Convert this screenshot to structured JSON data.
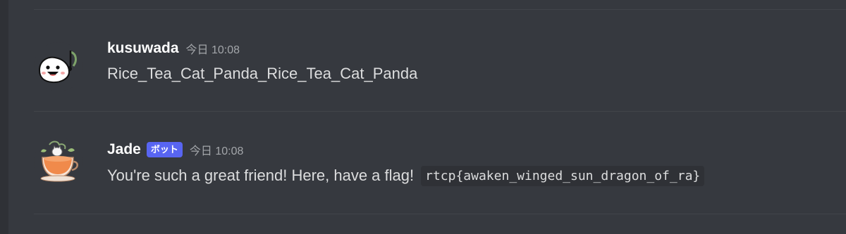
{
  "messages": [
    {
      "username": "kusuwada",
      "timestamp": "今日 10:08",
      "content": "Rice_Tea_Cat_Panda_Rice_Tea_Cat_Panda",
      "avatar_icon": "rice-ball-mascot-icon"
    },
    {
      "username": "Jade",
      "badge": "ボット",
      "timestamp": "今日 10:08",
      "content": "You're such a great friend! Here, have a flag!",
      "code": "rtcp{awaken_winged_sun_dragon_of_ra}",
      "avatar_icon": "teacup-cat-icon"
    }
  ],
  "colors": {
    "background": "#36393f",
    "username": "#ffffff",
    "message_text": "#dcddde",
    "timestamp": "#a3a6aa",
    "bot_badge": "#5865f2",
    "code_background": "#2f3136"
  }
}
